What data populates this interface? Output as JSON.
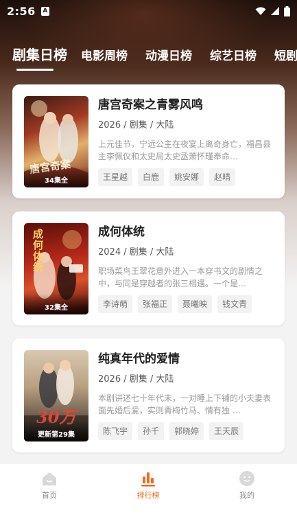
{
  "status": {
    "time": "2:56",
    "notif_badge": "A"
  },
  "tabs": [
    {
      "label": "剧集日榜"
    },
    {
      "label": "电影周榜"
    },
    {
      "label": "动漫日榜"
    },
    {
      "label": "综艺日榜"
    },
    {
      "label": "短剧"
    }
  ],
  "cards": [
    {
      "title": "唐宫奇案之青雾风鸣",
      "meta": "2026 / 剧集 / 大陆",
      "desc": "上元佳节，宁远公主在夜宴上离奇身亡，福昌县主李佩仪和太史局太史丞萧怀瑾奉命…",
      "badge": "34集全",
      "poster_text": "唐宫奇案",
      "tags": [
        "王星越",
        "白鹿",
        "姚安娜",
        "赵晴"
      ]
    },
    {
      "title": "成何体统",
      "meta": "2024 / 剧集 / 大陆",
      "desc": "职场菜鸟王翠花意外进入一本穿书文的剧情之中，与同是穿越者的张三相遇。一个是…",
      "badge": "32集全",
      "poster_text": "成何体统",
      "tags": [
        "李诗萌",
        "张福正",
        "聂曦映",
        "钱文青"
      ]
    },
    {
      "title": "纯真年代的爱情",
      "meta": "2026 / 剧集 / 大陆",
      "desc": "本剧讲述七十年代末，一对睡上下铺的小夫妻表面先婚后爱，实则青梅竹马、情有独 …",
      "badge": "更新第29集",
      "poster_text": "30万",
      "tags": [
        "陈飞宇",
        "孙千",
        "郭晓婷",
        "王天辰"
      ]
    }
  ],
  "bottom_nav": [
    {
      "label": "首页",
      "icon": "home-icon"
    },
    {
      "label": "排行榜",
      "icon": "ranking-icon"
    },
    {
      "label": "我的",
      "icon": "profile-icon"
    }
  ],
  "colors": {
    "accent": "#f06a1d",
    "text_primary": "#222222",
    "text_secondary": "#999999"
  }
}
